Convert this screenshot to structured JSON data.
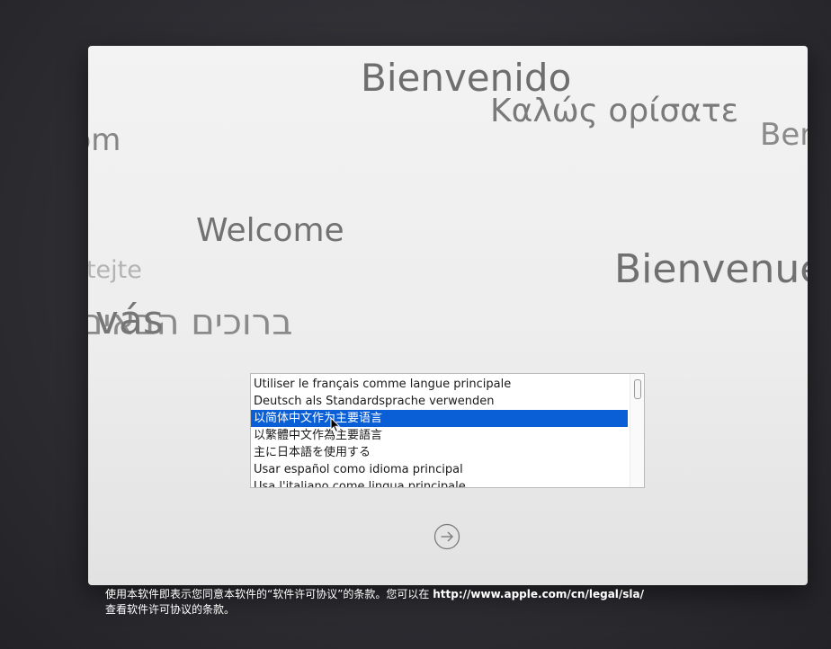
{
  "greetings": [
    "Bienvenido",
    "Καλώς ορίσατε",
    "Ben",
    "kom",
    "Welcome",
    "Vítejte",
    "Bienvenue",
    "me vás",
    "ברוכים הבאים"
  ],
  "language_list": {
    "items": [
      "Utiliser le français comme langue principale",
      "Deutsch als Standardsprache verwenden",
      "以简体中文作为主要语言",
      "以繁體中文作為主要語言",
      "主に日本語を使用する",
      "Usar español como idioma principal",
      "Usa l'italiano come lingua principale"
    ],
    "selected_index": 2
  },
  "next_button": {
    "icon": "arrow-right-circle-icon"
  },
  "footer": {
    "line1_text": "使用本软件即表示您同意本软件的“软件许可协议”的条款。您可以在 ",
    "line1_url": "http://www.apple.com/cn/legal/sla/",
    "line2_text": "查看软件许可协议的条款。"
  },
  "colors": {
    "selection": "#0b5fd6",
    "desktop_background": "#2c2c31",
    "window_background": "#efefef"
  }
}
